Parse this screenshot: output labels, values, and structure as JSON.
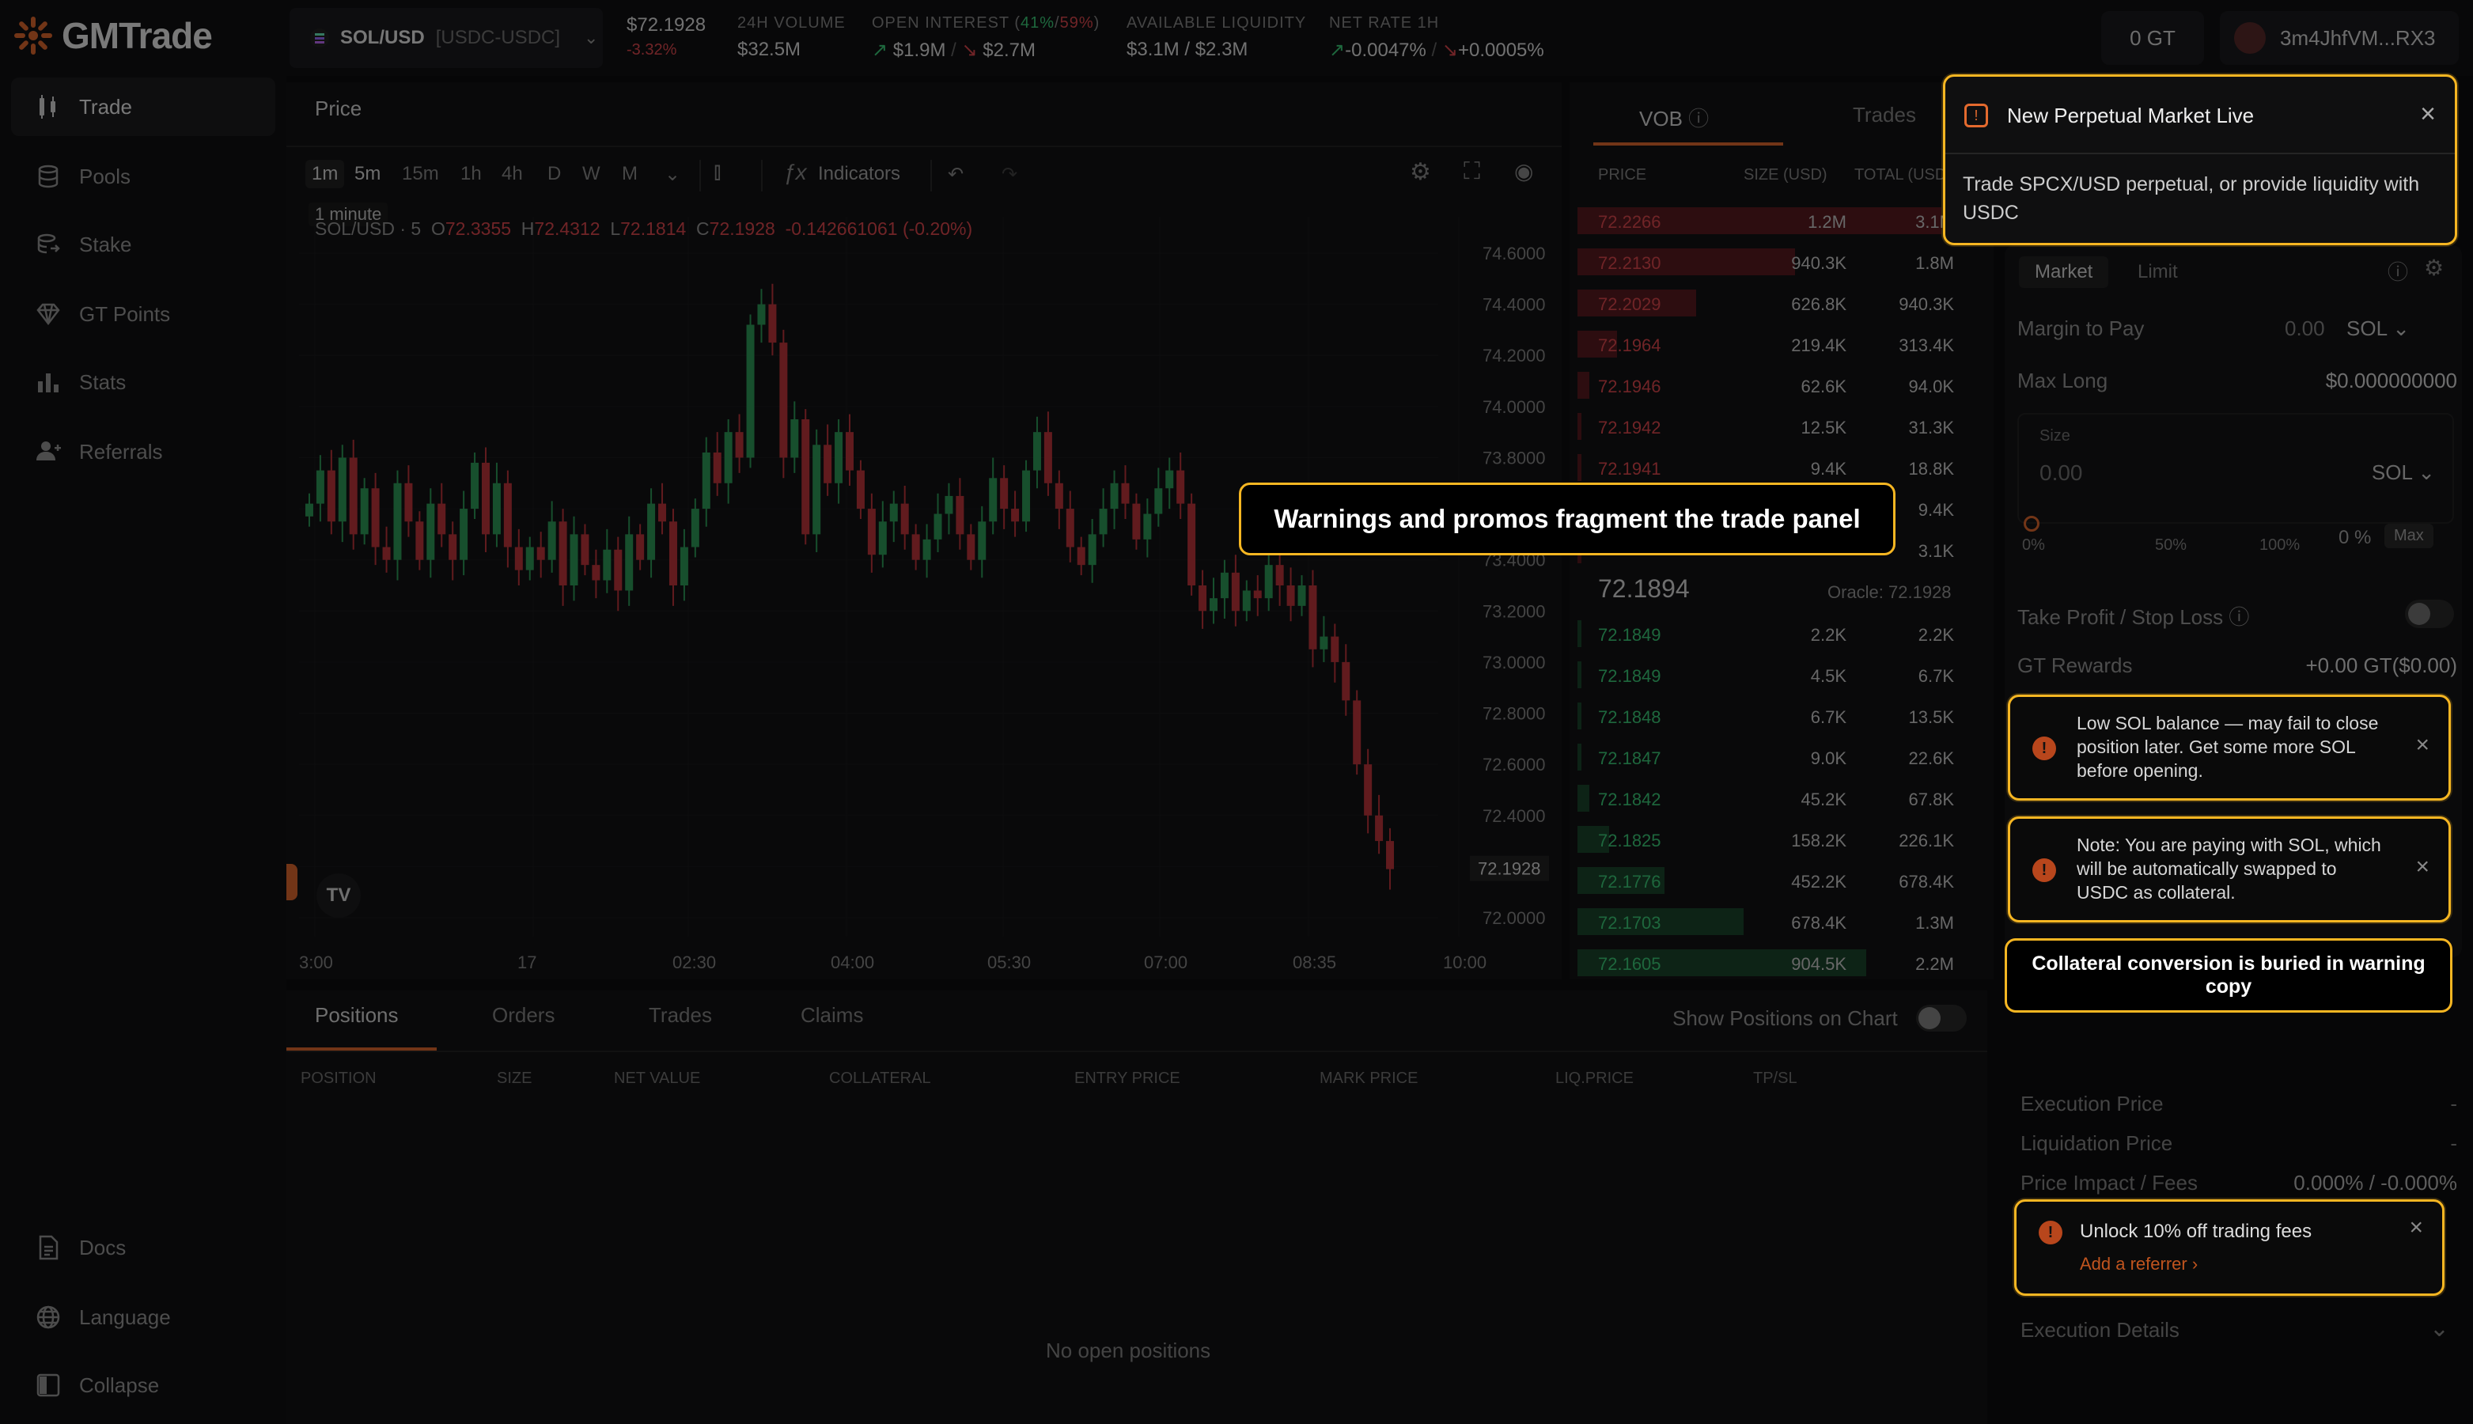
{
  "app": {
    "name": "GMTrade"
  },
  "sidebar": {
    "items": [
      {
        "label": "Trade",
        "icon": "candles-icon"
      },
      {
        "label": "Pools",
        "icon": "database-icon"
      },
      {
        "label": "Stake",
        "icon": "stake-icon"
      },
      {
        "label": "GT Points",
        "icon": "diamond-icon"
      },
      {
        "label": "Stats",
        "icon": "bar-chart-icon"
      },
      {
        "label": "Referrals",
        "icon": "user-plus-icon"
      }
    ],
    "bottom": [
      {
        "label": "Docs",
        "icon": "document-icon"
      },
      {
        "label": "Language",
        "icon": "globe-icon"
      },
      {
        "label": "Collapse",
        "icon": "collapse-icon"
      }
    ]
  },
  "header": {
    "pair": "SOL/USD",
    "pair_sub": "[USDC-USDC]",
    "price": "$72.1928",
    "change": "-3.32%",
    "volume_label": "24H VOLUME",
    "volume": "$32.5M",
    "oi_label": "OPEN INTEREST",
    "oi_long_pct": "41%",
    "oi_sep": "/",
    "oi_short_pct": "59%",
    "oi_long": "$1.9M",
    "oi_short": "$2.7M",
    "liq_label": "AVAILABLE LIQUIDITY",
    "liq": "$3.1M / $2.3M",
    "rate_label": "NET RATE 1H",
    "rate_long": "-0.0047%",
    "rate_short": "+0.0005%",
    "gt": "0 GT",
    "wallet": "3m4JhfVM...RX3"
  },
  "chart": {
    "tab": "Price",
    "timeframes": [
      "1m",
      "5m",
      "15m",
      "1h",
      "4h",
      "D",
      "W",
      "M"
    ],
    "indicators": "Indicators",
    "tooltip": "1 minute",
    "legend_symbol": "SOL/USD · 5",
    "o": "72.3355",
    "h": "72.4312",
    "l": "72.1814",
    "c": "72.1928",
    "chg": "-0.142661061 (-0.20%)",
    "current_price": "72.1928",
    "y_ticks": [
      "74.6000",
      "74.4000",
      "74.2000",
      "74.0000",
      "73.8000",
      "73.6000",
      "73.4000",
      "73.2000",
      "73.0000",
      "72.8000",
      "72.6000",
      "72.4000",
      "72.2000",
      "72.0000"
    ],
    "x_ticks": [
      "3:00",
      "17",
      "02:30",
      "04:00",
      "05:30",
      "07:00",
      "08:35",
      "10:00"
    ]
  },
  "chart_data": {
    "type": "candlestick",
    "x_ticks": [
      "3:00",
      "17",
      "02:30",
      "04:00",
      "05:30",
      "07:00",
      "08:35",
      "10:00"
    ],
    "ylim": [
      72.0,
      74.6
    ],
    "closes": [
      73.62,
      73.75,
      73.55,
      73.8,
      73.5,
      73.68,
      73.45,
      73.4,
      73.7,
      73.55,
      73.4,
      73.62,
      73.5,
      73.4,
      73.6,
      73.78,
      73.5,
      73.7,
      73.45,
      73.36,
      73.45,
      73.4,
      73.55,
      73.3,
      73.5,
      73.38,
      73.32,
      73.44,
      73.28,
      73.5,
      73.4,
      73.62,
      73.55,
      73.3,
      73.45,
      73.6,
      73.82,
      73.7,
      73.9,
      73.8,
      74.32,
      74.4,
      74.25,
      73.8,
      73.95,
      73.5,
      73.85,
      73.7,
      73.9,
      73.75,
      73.6,
      73.42,
      73.55,
      73.62,
      73.5,
      73.4,
      73.48,
      73.58,
      73.65,
      73.5,
      73.4,
      73.55,
      73.72,
      73.6,
      73.55,
      73.75,
      73.9,
      73.7,
      73.6,
      73.45,
      73.38,
      73.5,
      73.6,
      73.7,
      73.62,
      73.48,
      73.58,
      73.68,
      73.75,
      73.62,
      73.3,
      73.2,
      73.25,
      73.35,
      73.2,
      73.28,
      73.25,
      73.38,
      73.3,
      73.22,
      73.3,
      73.05,
      73.1,
      73.0,
      72.85,
      72.6,
      72.4,
      72.3,
      72.19
    ]
  },
  "orderbook": {
    "tabs": [
      "VOB",
      "Trades"
    ],
    "headers": [
      "PRICE",
      "SIZE (USD)",
      "TOTAL (USD)"
    ],
    "asks": [
      {
        "p": "72.2266",
        "s": "1.2M",
        "t": "3.1M",
        "w": 0.92
      },
      {
        "p": "72.2130",
        "s": "940.3K",
        "t": "1.8M",
        "w": 0.55
      },
      {
        "p": "72.2029",
        "s": "626.8K",
        "t": "940.3K",
        "w": 0.3
      },
      {
        "p": "72.1964",
        "s": "219.4K",
        "t": "313.4K",
        "w": 0.1
      },
      {
        "p": "72.1946",
        "s": "62.6K",
        "t": "94.0K",
        "w": 0.03
      },
      {
        "p": "72.1942",
        "s": "12.5K",
        "t": "31.3K",
        "w": 0.01
      },
      {
        "p": "72.1941",
        "s": "9.4K",
        "t": "18.8K",
        "w": 0.01
      },
      {
        "p": "",
        "s": "",
        "t": "9.4K",
        "w": 0.01
      },
      {
        "p": "",
        "s": "",
        "t": "3.1K",
        "w": 0.01
      }
    ],
    "mid": "72.1894",
    "oracle": "Oracle: 72.1928",
    "bids": [
      {
        "p": "72.1849",
        "s": "2.2K",
        "t": "2.2K",
        "w": 0.01
      },
      {
        "p": "72.1849",
        "s": "4.5K",
        "t": "6.7K",
        "w": 0.01
      },
      {
        "p": "72.1848",
        "s": "6.7K",
        "t": "13.5K",
        "w": 0.01
      },
      {
        "p": "72.1847",
        "s": "9.0K",
        "t": "22.6K",
        "w": 0.01
      },
      {
        "p": "72.1842",
        "s": "45.2K",
        "t": "67.8K",
        "w": 0.03
      },
      {
        "p": "72.1825",
        "s": "158.2K",
        "t": "226.1K",
        "w": 0.08
      },
      {
        "p": "72.1776",
        "s": "452.2K",
        "t": "678.4K",
        "w": 0.22
      },
      {
        "p": "72.1703",
        "s": "678.4K",
        "t": "1.3M",
        "w": 0.42
      },
      {
        "p": "72.1605",
        "s": "904.5K",
        "t": "2.2M",
        "w": 0.73
      }
    ]
  },
  "trade": {
    "order_tabs": [
      "Market",
      "Limit"
    ],
    "margin_label": "Margin to Pay",
    "margin_value": "0.00",
    "token": "SOL",
    "max_long_label": "Max Long",
    "max_long_value": "$0.000000000",
    "size_label": "Size",
    "size_value": "0.00",
    "slider": [
      "0%",
      "50%",
      "100%"
    ],
    "slider_value": "0 %",
    "max_btn": "Max",
    "tpsl": "Take Profit / Stop Loss",
    "gt_rewards": "GT Rewards",
    "gt_rewards_value": "+0.00 GT($0.00)",
    "warning1": "Low SOL balance — may fail to close position later. Get some more SOL before opening.",
    "warning2": "Note: You are paying with SOL, which will be automatically swapped to USDC as collateral.",
    "exec_price": "Execution Price",
    "exec_price_val": "-",
    "liq_price": "Liquidation Price",
    "liq_price_val": "-",
    "impact": "Price Impact / Fees",
    "impact_val": "0.000% / -0.000%",
    "promo_title": "Unlock 10% off trading fees",
    "promo_link": "Add a referrer",
    "exec_details": "Execution Details"
  },
  "toast": {
    "title": "New Perpetual Market Live",
    "body": "Trade SPCX/USD perpetual, or provide liquidity with USDC"
  },
  "positions": {
    "tabs": [
      "Positions",
      "Orders",
      "Trades",
      "Claims"
    ],
    "show_label": "Show Positions on Chart",
    "headers": [
      "POSITION",
      "SIZE",
      "NET VALUE",
      "COLLATERAL",
      "ENTRY PRICE",
      "MARK PRICE",
      "LIQ.PRICE",
      "TP/SL"
    ],
    "empty": "No open positions"
  },
  "annotations": {
    "callout1": "Warnings and promos fragment the trade panel",
    "callout2": "Collateral conversion is buried in warning copy"
  },
  "colors": {
    "accent": "#f6b622",
    "up": "#3ccf7a",
    "down": "#e0494f"
  }
}
